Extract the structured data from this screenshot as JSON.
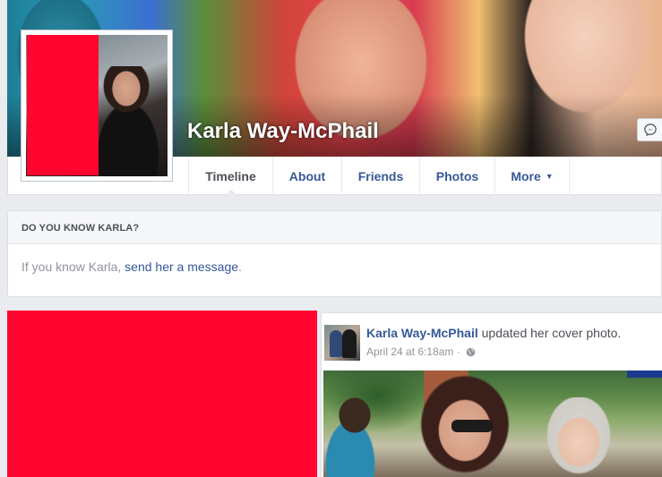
{
  "profile": {
    "name": "Karla Way-McPhail"
  },
  "nav": {
    "tabs": [
      {
        "label": "Timeline",
        "active": true
      },
      {
        "label": "About"
      },
      {
        "label": "Friends"
      },
      {
        "label": "Photos"
      },
      {
        "label": "More",
        "has_caret": true
      }
    ],
    "more_caret_icon": "caret-down-icon",
    "messenger_icon": "messenger-icon"
  },
  "know_card": {
    "header": "DO YOU KNOW KARLA?",
    "text_prefix": "If you know Karla, ",
    "link": "send her a message",
    "text_suffix": "."
  },
  "post": {
    "author": "Karla Way-McPhail",
    "action": "updated her cover photo.",
    "timestamp": "April 24 at 6:18am · ",
    "privacy_icon": "globe-icon"
  },
  "colors": {
    "redaction": "#ff0530",
    "link": "#365899",
    "muted": "#90949c",
    "background": "#e9ebee"
  }
}
